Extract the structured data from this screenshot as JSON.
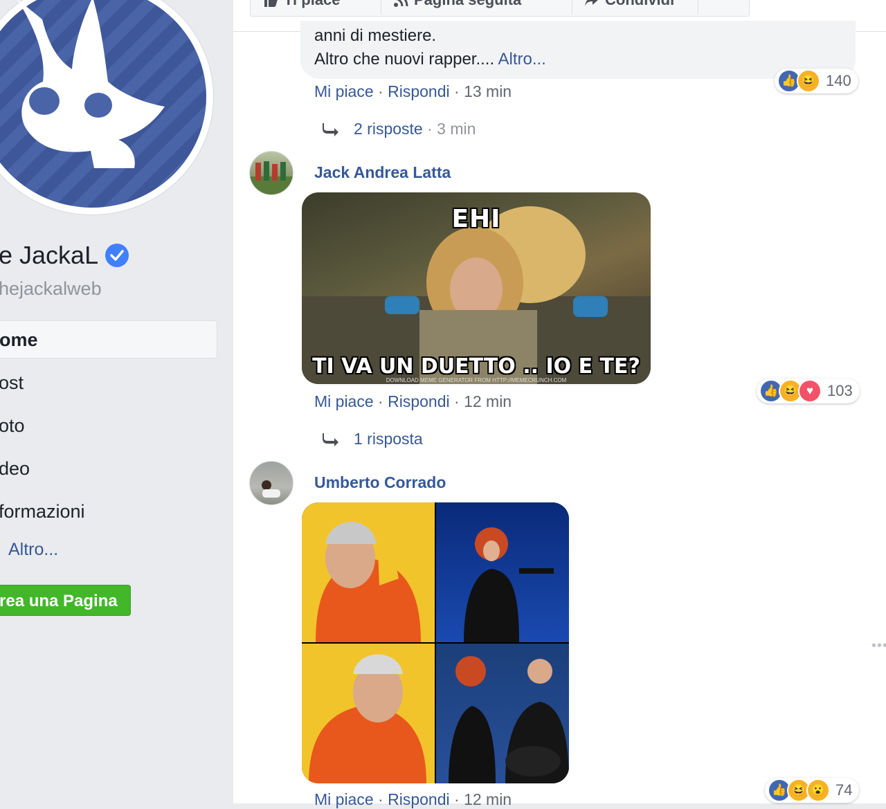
{
  "sidebar": {
    "page_name": "e JackaL",
    "page_handle": "hejackalweb",
    "nav": [
      "ome",
      "ost",
      "oto",
      "deo",
      "formazioni"
    ],
    "more": "Altro...",
    "create_page": "rea una Pagina"
  },
  "topbar": {
    "like": "Ti piace",
    "follow": "Pagina seguita",
    "share": "Condividi"
  },
  "comments": [
    {
      "text_line1": "anni di mestiere.",
      "text_line2": "Altro che nuovi rapper....",
      "more": "Altro...",
      "actions": {
        "like": "Mi piace",
        "reply": "Rispondi",
        "time": "13 min"
      },
      "reactions": {
        "types": [
          "like",
          "haha"
        ],
        "count": "140"
      },
      "replies": {
        "label": "2 risposte",
        "time": "3 min"
      }
    },
    {
      "author": "Jack Andrea Latta",
      "meme": {
        "top_text": "EHI",
        "bottom_text": "TI VA UN DUETTO .. IO E TE?",
        "credit": "DOWNLOAD MEME GENERATOR FROM HTTP://MEMECRUNCH.COM"
      },
      "actions": {
        "like": "Mi piace",
        "reply": "Rispondi",
        "time": "12 min"
      },
      "reactions": {
        "types": [
          "like",
          "haha",
          "love"
        ],
        "count": "103"
      },
      "replies": {
        "label": "1 risposta"
      }
    },
    {
      "author": "Umberto Corrado",
      "actions": {
        "like": "Mi piace",
        "reply": "Rispondi",
        "time": "12 min"
      },
      "reactions": {
        "types": [
          "like",
          "haha",
          "wow"
        ],
        "count": "74"
      }
    }
  ],
  "colors": {
    "link": "#365899",
    "facebook_blue": "#4267b2",
    "create_button": "#42b72a",
    "background": "#e9ebee"
  }
}
